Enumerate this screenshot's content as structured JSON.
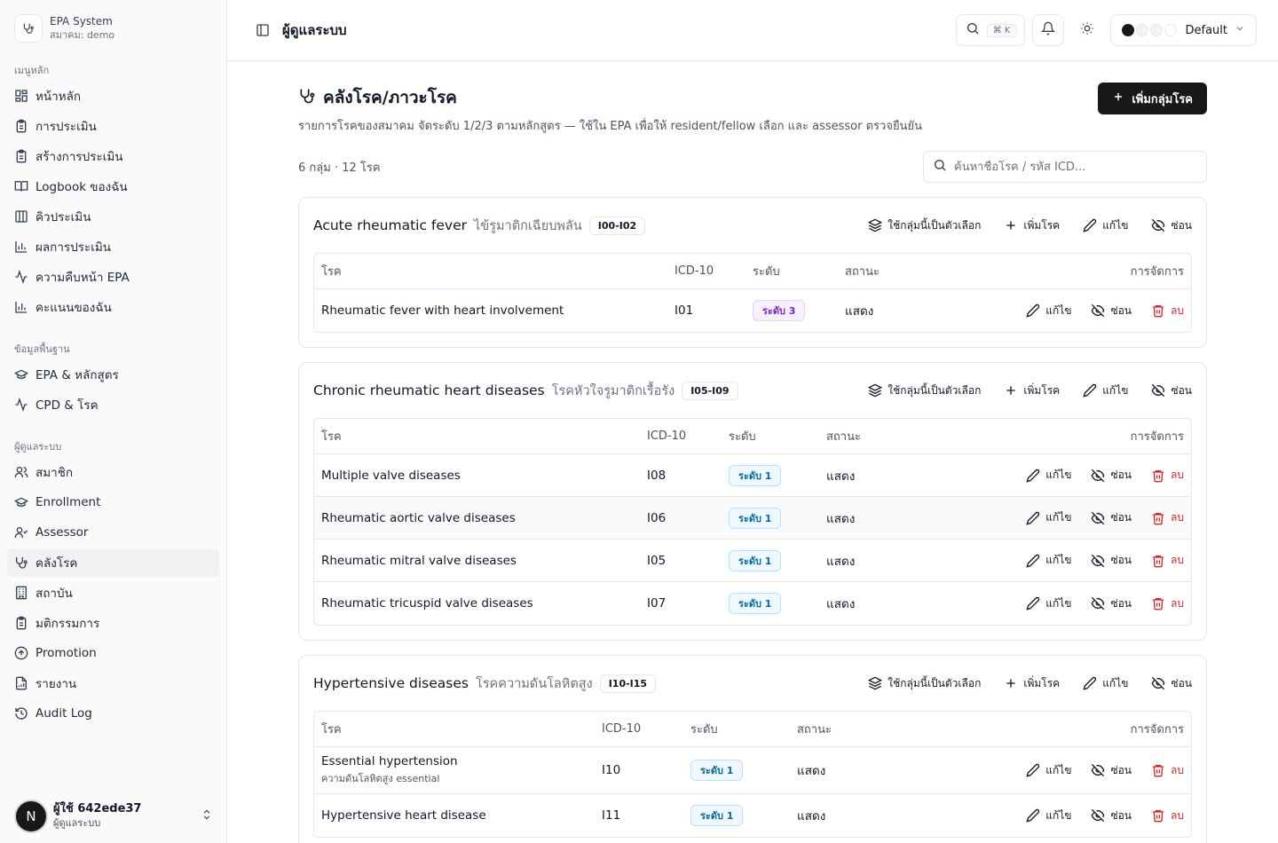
{
  "sidebar": {
    "brand_title": "EPA System",
    "brand_sub": "สมาคม: demo",
    "sections": [
      {
        "label": "เมนูหลัก",
        "items": [
          {
            "label": "หน้าหลัก",
            "icon": "grid-icon"
          },
          {
            "label": "การประเมิน",
            "icon": "clipboard-icon"
          },
          {
            "label": "สร้างการประเมิน",
            "icon": "clipboard-icon"
          },
          {
            "label": "Logbook ของฉัน",
            "icon": "book-icon"
          },
          {
            "label": "คิวประเมิน",
            "icon": "columns-icon"
          },
          {
            "label": "ผลการประเมิน",
            "icon": "bar-chart-icon"
          },
          {
            "label": "ความคืบหน้า EPA",
            "icon": "activity-icon"
          },
          {
            "label": "คะแนนของฉัน",
            "icon": "bar-chart-icon"
          }
        ]
      },
      {
        "label": "ข้อมูลพื้นฐาน",
        "items": [
          {
            "label": "EPA & หลักสูตร",
            "icon": "graduation-cap-icon"
          },
          {
            "label": "CPD & โรค",
            "icon": "activity-icon"
          }
        ]
      },
      {
        "label": "ผู้ดูแลระบบ",
        "items": [
          {
            "label": "สมาชิก",
            "icon": "users-icon"
          },
          {
            "label": "Enrollment",
            "icon": "graduation-cap-icon"
          },
          {
            "label": "Assessor",
            "icon": "user-check-icon"
          },
          {
            "label": "คลังโรค",
            "icon": "stethoscope-icon"
          },
          {
            "label": "สถาบัน",
            "icon": "building-icon"
          },
          {
            "label": "มติกรรมการ",
            "icon": "clipboard-icon"
          },
          {
            "label": "Promotion",
            "icon": "arrow-up-circle-icon"
          },
          {
            "label": "รายงาน",
            "icon": "file-chart-icon"
          },
          {
            "label": "Audit Log",
            "icon": "history-icon"
          }
        ]
      }
    ],
    "user": {
      "initial": "N",
      "name": "ผู้ใช้ 642ede37",
      "role": "ผู้ดูแลระบบ"
    }
  },
  "topbar": {
    "title": "ผู้ดูแลระบบ",
    "kbd": "⌘ K",
    "theme_label": "Default",
    "swatches": [
      "#18181b",
      "#f4f4f5",
      "#f4f4f5",
      "#ffffff"
    ]
  },
  "page": {
    "title": "คลังโรค/ภาวะโรค",
    "subtitle": "รายการโรคของสมาคม จัดระดับ 1/2/3 ตามหลักสูตร — ใช้ใน EPA เพื่อให้ resident/fellow เลือก และ assessor ตรวจยืนยัน",
    "add_group_label": "เพิ่มกลุ่มโรค",
    "summary": "6 กลุ่ม · 12 โรค",
    "search_placeholder": "ค้นหาชื่อโรค / รหัส ICD..."
  },
  "labels": {
    "use_group": "ใช้กลุ่มนี้เป็นตัวเลือก",
    "add_disease": "เพิ่มโรค",
    "edit": "แก้ไข",
    "hide": "ซ่อน",
    "delete": "ลบ",
    "col_disease": "โรค",
    "col_icd": "ICD-10",
    "col_level": "ระดับ",
    "col_status": "สถานะ",
    "col_actions": "การจัดการ"
  },
  "groups": [
    {
      "name": "Acute rheumatic fever",
      "thai": "ไข้รูมาติกเฉียบพลัน",
      "icd": "I00-I02",
      "diseases": [
        {
          "name": "Rheumatic fever with heart involvement",
          "sub": "",
          "icd": "I01",
          "level": "ระดับ 3",
          "level_num": 3,
          "status": "แสดง"
        }
      ]
    },
    {
      "name": "Chronic rheumatic heart diseases",
      "thai": "โรคหัวใจรูมาติกเรื้อรัง",
      "icd": "I05-I09",
      "diseases": [
        {
          "name": "Multiple valve diseases",
          "sub": "",
          "icd": "I08",
          "level": "ระดับ 1",
          "level_num": 1,
          "status": "แสดง"
        },
        {
          "name": "Rheumatic aortic valve diseases",
          "sub": "",
          "icd": "I06",
          "level": "ระดับ 1",
          "level_num": 1,
          "status": "แสดง"
        },
        {
          "name": "Rheumatic mitral valve diseases",
          "sub": "",
          "icd": "I05",
          "level": "ระดับ 1",
          "level_num": 1,
          "status": "แสดง"
        },
        {
          "name": "Rheumatic tricuspid valve diseases",
          "sub": "",
          "icd": "I07",
          "level": "ระดับ 1",
          "level_num": 1,
          "status": "แสดง"
        }
      ]
    },
    {
      "name": "Hypertensive diseases",
      "thai": "โรคความดันโลหิตสูง",
      "icd": "I10-I15",
      "diseases": [
        {
          "name": "Essential hypertension",
          "sub": "ความดันโลหิตสูง essential",
          "icd": "I10",
          "level": "ระดับ 1",
          "level_num": 1,
          "status": "แสดง"
        },
        {
          "name": "Hypertensive heart disease",
          "sub": "",
          "icd": "I11",
          "level": "ระดับ 1",
          "level_num": 1,
          "status": "แสดง"
        }
      ]
    }
  ]
}
